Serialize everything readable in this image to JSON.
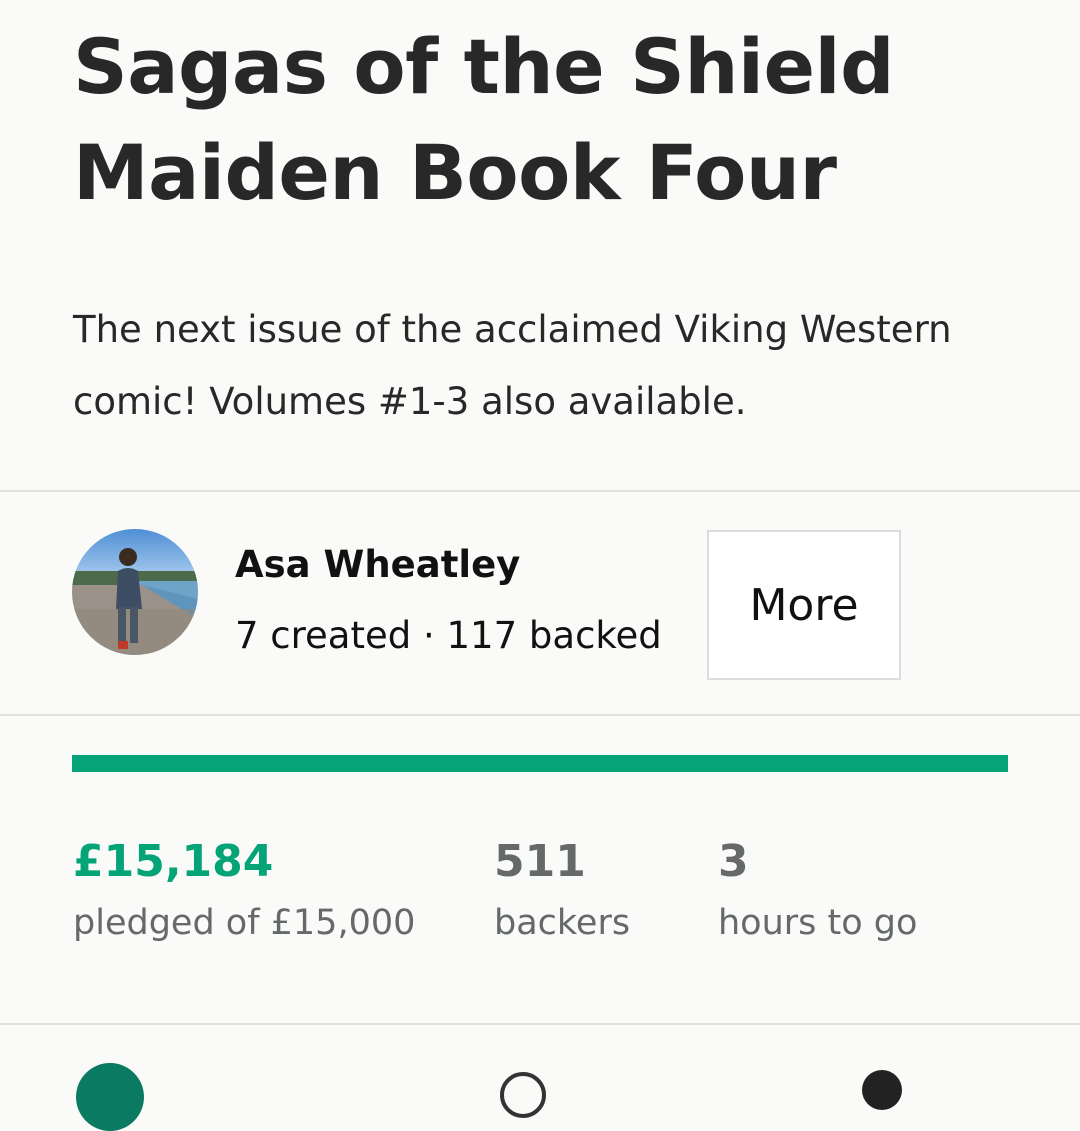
{
  "project": {
    "title": "Sagas of the Shield Maiden Book Four",
    "blurb": "The next issue of the acclaimed Viking Western comic! Volumes #1-3 also available."
  },
  "creator": {
    "name": "Asa Wheatley",
    "stats": "7 created · 117 backed",
    "more_label": "More"
  },
  "funding": {
    "progress_fraction": 1.0,
    "pledged": "£15,184",
    "pledged_label": "pledged of £15,000",
    "backers": "511",
    "backers_label": "backers",
    "time_left": "3",
    "time_left_label": "hours to go"
  },
  "colors": {
    "accent": "#05a378",
    "text": "#282828",
    "muted": "#656969",
    "background": "#fafaf8"
  }
}
